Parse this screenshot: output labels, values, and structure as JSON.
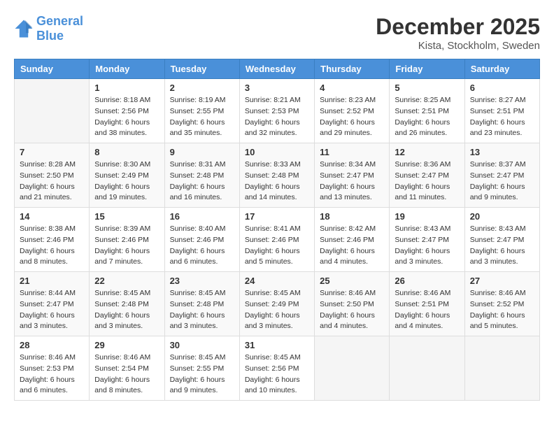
{
  "header": {
    "logo_line1": "General",
    "logo_line2": "Blue",
    "month_title": "December 2025",
    "location": "Kista, Stockholm, Sweden"
  },
  "days_of_week": [
    "Sunday",
    "Monday",
    "Tuesday",
    "Wednesday",
    "Thursday",
    "Friday",
    "Saturday"
  ],
  "weeks": [
    [
      {
        "day": "",
        "sunrise": "",
        "sunset": "",
        "daylight": ""
      },
      {
        "day": "1",
        "sunrise": "Sunrise: 8:18 AM",
        "sunset": "Sunset: 2:56 PM",
        "daylight": "Daylight: 6 hours and 38 minutes."
      },
      {
        "day": "2",
        "sunrise": "Sunrise: 8:19 AM",
        "sunset": "Sunset: 2:55 PM",
        "daylight": "Daylight: 6 hours and 35 minutes."
      },
      {
        "day": "3",
        "sunrise": "Sunrise: 8:21 AM",
        "sunset": "Sunset: 2:53 PM",
        "daylight": "Daylight: 6 hours and 32 minutes."
      },
      {
        "day": "4",
        "sunrise": "Sunrise: 8:23 AM",
        "sunset": "Sunset: 2:52 PM",
        "daylight": "Daylight: 6 hours and 29 minutes."
      },
      {
        "day": "5",
        "sunrise": "Sunrise: 8:25 AM",
        "sunset": "Sunset: 2:51 PM",
        "daylight": "Daylight: 6 hours and 26 minutes."
      },
      {
        "day": "6",
        "sunrise": "Sunrise: 8:27 AM",
        "sunset": "Sunset: 2:51 PM",
        "daylight": "Daylight: 6 hours and 23 minutes."
      }
    ],
    [
      {
        "day": "7",
        "sunrise": "Sunrise: 8:28 AM",
        "sunset": "Sunset: 2:50 PM",
        "daylight": "Daylight: 6 hours and 21 minutes."
      },
      {
        "day": "8",
        "sunrise": "Sunrise: 8:30 AM",
        "sunset": "Sunset: 2:49 PM",
        "daylight": "Daylight: 6 hours and 19 minutes."
      },
      {
        "day": "9",
        "sunrise": "Sunrise: 8:31 AM",
        "sunset": "Sunset: 2:48 PM",
        "daylight": "Daylight: 6 hours and 16 minutes."
      },
      {
        "day": "10",
        "sunrise": "Sunrise: 8:33 AM",
        "sunset": "Sunset: 2:48 PM",
        "daylight": "Daylight: 6 hours and 14 minutes."
      },
      {
        "day": "11",
        "sunrise": "Sunrise: 8:34 AM",
        "sunset": "Sunset: 2:47 PM",
        "daylight": "Daylight: 6 hours and 13 minutes."
      },
      {
        "day": "12",
        "sunrise": "Sunrise: 8:36 AM",
        "sunset": "Sunset: 2:47 PM",
        "daylight": "Daylight: 6 hours and 11 minutes."
      },
      {
        "day": "13",
        "sunrise": "Sunrise: 8:37 AM",
        "sunset": "Sunset: 2:47 PM",
        "daylight": "Daylight: 6 hours and 9 minutes."
      }
    ],
    [
      {
        "day": "14",
        "sunrise": "Sunrise: 8:38 AM",
        "sunset": "Sunset: 2:46 PM",
        "daylight": "Daylight: 6 hours and 8 minutes."
      },
      {
        "day": "15",
        "sunrise": "Sunrise: 8:39 AM",
        "sunset": "Sunset: 2:46 PM",
        "daylight": "Daylight: 6 hours and 7 minutes."
      },
      {
        "day": "16",
        "sunrise": "Sunrise: 8:40 AM",
        "sunset": "Sunset: 2:46 PM",
        "daylight": "Daylight: 6 hours and 6 minutes."
      },
      {
        "day": "17",
        "sunrise": "Sunrise: 8:41 AM",
        "sunset": "Sunset: 2:46 PM",
        "daylight": "Daylight: 6 hours and 5 minutes."
      },
      {
        "day": "18",
        "sunrise": "Sunrise: 8:42 AM",
        "sunset": "Sunset: 2:46 PM",
        "daylight": "Daylight: 6 hours and 4 minutes."
      },
      {
        "day": "19",
        "sunrise": "Sunrise: 8:43 AM",
        "sunset": "Sunset: 2:47 PM",
        "daylight": "Daylight: 6 hours and 3 minutes."
      },
      {
        "day": "20",
        "sunrise": "Sunrise: 8:43 AM",
        "sunset": "Sunset: 2:47 PM",
        "daylight": "Daylight: 6 hours and 3 minutes."
      }
    ],
    [
      {
        "day": "21",
        "sunrise": "Sunrise: 8:44 AM",
        "sunset": "Sunset: 2:47 PM",
        "daylight": "Daylight: 6 hours and 3 minutes."
      },
      {
        "day": "22",
        "sunrise": "Sunrise: 8:45 AM",
        "sunset": "Sunset: 2:48 PM",
        "daylight": "Daylight: 6 hours and 3 minutes."
      },
      {
        "day": "23",
        "sunrise": "Sunrise: 8:45 AM",
        "sunset": "Sunset: 2:48 PM",
        "daylight": "Daylight: 6 hours and 3 minutes."
      },
      {
        "day": "24",
        "sunrise": "Sunrise: 8:45 AM",
        "sunset": "Sunset: 2:49 PM",
        "daylight": "Daylight: 6 hours and 3 minutes."
      },
      {
        "day": "25",
        "sunrise": "Sunrise: 8:46 AM",
        "sunset": "Sunset: 2:50 PM",
        "daylight": "Daylight: 6 hours and 4 minutes."
      },
      {
        "day": "26",
        "sunrise": "Sunrise: 8:46 AM",
        "sunset": "Sunset: 2:51 PM",
        "daylight": "Daylight: 6 hours and 4 minutes."
      },
      {
        "day": "27",
        "sunrise": "Sunrise: 8:46 AM",
        "sunset": "Sunset: 2:52 PM",
        "daylight": "Daylight: 6 hours and 5 minutes."
      }
    ],
    [
      {
        "day": "28",
        "sunrise": "Sunrise: 8:46 AM",
        "sunset": "Sunset: 2:53 PM",
        "daylight": "Daylight: 6 hours and 6 minutes."
      },
      {
        "day": "29",
        "sunrise": "Sunrise: 8:46 AM",
        "sunset": "Sunset: 2:54 PM",
        "daylight": "Daylight: 6 hours and 8 minutes."
      },
      {
        "day": "30",
        "sunrise": "Sunrise: 8:45 AM",
        "sunset": "Sunset: 2:55 PM",
        "daylight": "Daylight: 6 hours and 9 minutes."
      },
      {
        "day": "31",
        "sunrise": "Sunrise: 8:45 AM",
        "sunset": "Sunset: 2:56 PM",
        "daylight": "Daylight: 6 hours and 10 minutes."
      },
      {
        "day": "",
        "sunrise": "",
        "sunset": "",
        "daylight": ""
      },
      {
        "day": "",
        "sunrise": "",
        "sunset": "",
        "daylight": ""
      },
      {
        "day": "",
        "sunrise": "",
        "sunset": "",
        "daylight": ""
      }
    ]
  ]
}
